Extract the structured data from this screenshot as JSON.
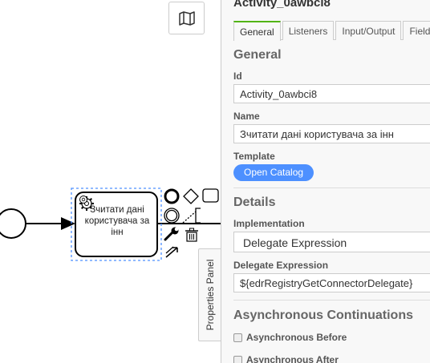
{
  "canvas": {
    "task_label": "Зчитати дані користувача за інн",
    "map_icon": "map-icon",
    "context_pad_icons": [
      "end-event-icon",
      "gateway-icon",
      "task-icon",
      "intermediate-event-icon",
      "text-annotation-icon",
      "wrench-icon",
      "trash-icon",
      "connect-icon"
    ]
  },
  "toggle": {
    "label": "Properties Panel"
  },
  "panel": {
    "title": "Activity_0awbci8",
    "tabs": [
      "General",
      "Listeners",
      "Input/Output",
      "Field Injections"
    ],
    "general": {
      "title": "General",
      "id_label": "Id",
      "id_value": "Activity_0awbci8",
      "name_label": "Name",
      "name_value": "Зчитати дані користувача за інн",
      "template_label": "Template",
      "open_catalog": "Open Catalog"
    },
    "details": {
      "title": "Details",
      "implementation_label": "Implementation",
      "implementation_value": "Delegate Expression",
      "delegate_label": "Delegate Expression",
      "delegate_value": "${edrRegistryGetConnectorDelegate}"
    },
    "async": {
      "title": "Asynchronous Continuations",
      "before": "Asynchronous Before",
      "after": "Asynchronous After"
    }
  },
  "colors": {
    "accent_tab": "#52b415",
    "button": "#4d90ff",
    "selection": "#4d90ff"
  }
}
